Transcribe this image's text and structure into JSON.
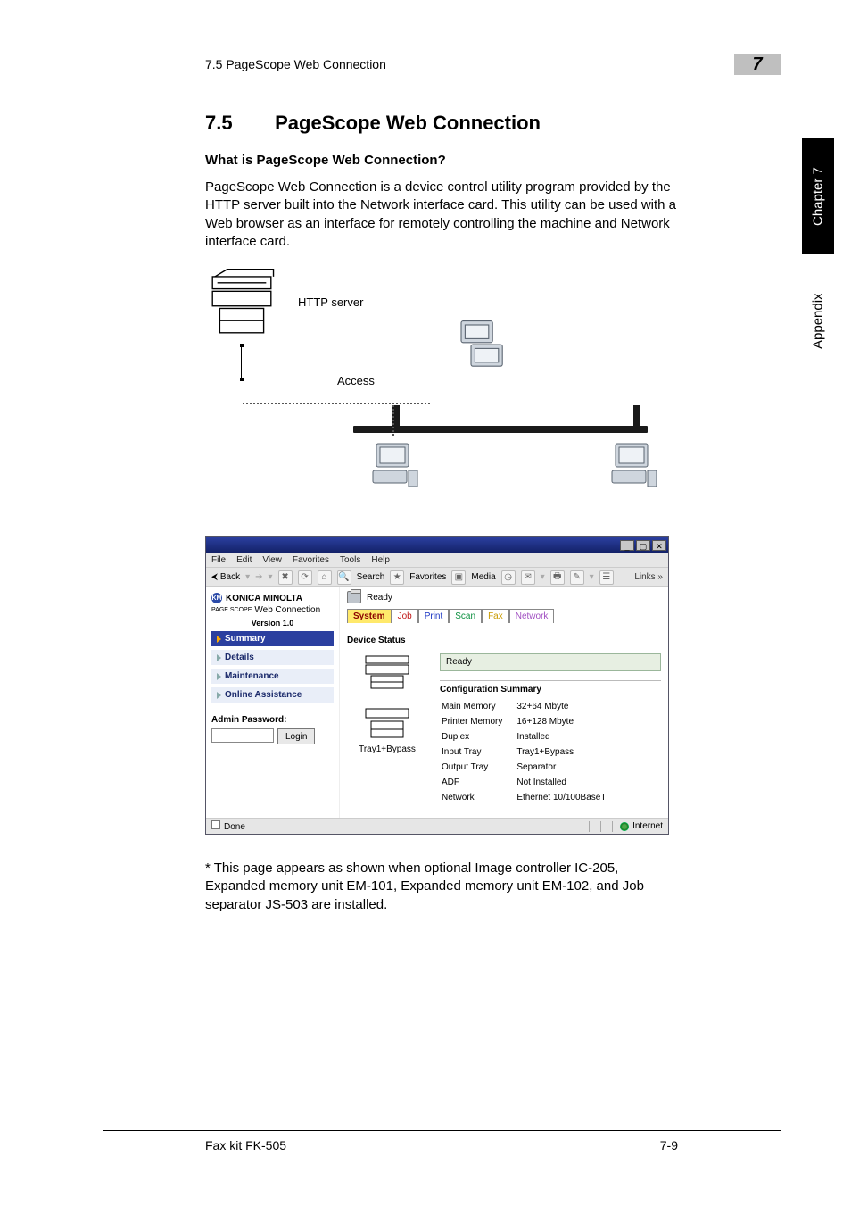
{
  "runhead": {
    "left": "7.5 PageScope Web Connection",
    "right": "7"
  },
  "side": {
    "chapter": "Chapter 7",
    "appendix": "Appendix"
  },
  "section": {
    "num": "7.5",
    "title": "PageScope Web Connection"
  },
  "subheading": "What is PageScope Web Connection?",
  "paragraph": "PageScope Web Connection is a device control utility program provided by the HTTP server built into the Network interface card. This utility can be used with a Web browser as an interface for remotely controlling the machine and Network interface card.",
  "diagram": {
    "http_label": "HTTP server",
    "access_label": "Access"
  },
  "browser": {
    "menu": [
      "File",
      "Edit",
      "View",
      "Favorites",
      "Tools",
      "Help"
    ],
    "toolbar": {
      "back": "Back",
      "search": "Search",
      "favorites": "Favorites",
      "media": "Media",
      "links": "Links »"
    },
    "brand": "KONICA MINOLTA",
    "subbrand_small": "PAGE SCOPE",
    "subbrand_rest": "Web Connection",
    "version": "Version 1.0",
    "nav": {
      "summary": "Summary",
      "details": "Details",
      "maintenance": "Maintenance",
      "online": "Online Assistance"
    },
    "admin_label": "Admin Password:",
    "login_btn": "Login",
    "status_ready": "Ready",
    "tabs": {
      "system": "System",
      "job": "Job",
      "print": "Print",
      "scan": "Scan",
      "fax": "Fax",
      "network": "Network"
    },
    "device_status": "Device Status",
    "tray_caption": "Tray1+Bypass",
    "ready_field": "Ready",
    "config_title": "Configuration Summary",
    "config_rows": {
      "r0k": "Main Memory",
      "r0v": "32+64 Mbyte",
      "r1k": "Printer Memory",
      "r1v": "16+128 Mbyte",
      "r2k": "Duplex",
      "r2v": "Installed",
      "r3k": "Input Tray",
      "r3v": "Tray1+Bypass",
      "r4k": "Output Tray",
      "r4v": "Separator",
      "r5k": "ADF",
      "r5v": "Not Installed",
      "r6k": "Network",
      "r6v": "Ethernet 10/100BaseT"
    },
    "statusbar": {
      "done": "Done",
      "zone": "Internet"
    }
  },
  "footnote": "* This page appears as shown when optional Image controller IC-205, Expanded memory unit EM-101, Expanded memory unit EM-102, and Job separator JS-503 are installed.",
  "footer": {
    "left": "Fax kit FK-505",
    "right": "7-9"
  }
}
